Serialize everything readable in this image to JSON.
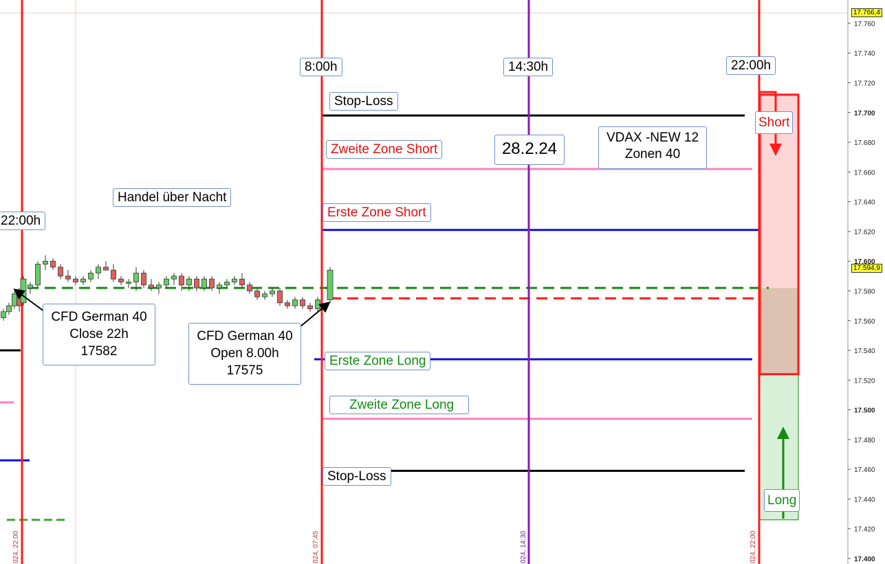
{
  "chart_data": {
    "type": "candlestick",
    "title": "",
    "xlabel": "",
    "ylabel": "",
    "ylim": [
      17400,
      17770
    ],
    "grid": true,
    "price_axis": {
      "ticks": [
        "17.760",
        "17.740",
        "17.720",
        "17.700",
        "17.680",
        "17.660",
        "17.640",
        "17.620",
        "17.600",
        "17.580",
        "17.560",
        "17.540",
        "17.520",
        "17.500",
        "17.480",
        "17.460",
        "17.440",
        "17.420",
        "17.400"
      ],
      "bold_ticks": [
        "17.700",
        "17.600",
        "17.500",
        "17.400"
      ],
      "tick_values": [
        17760,
        17740,
        17720,
        17700,
        17680,
        17660,
        17640,
        17620,
        17600,
        17580,
        17560,
        17540,
        17520,
        17500,
        17480,
        17460,
        17440,
        17420,
        17400
      ],
      "current_high_label": "17.766,4",
      "current_high_value": 17766.4,
      "last_price_label": "17.594,9",
      "last_price_value": 17594.9
    },
    "time_markers": [
      {
        "label": "22:00h",
        "stamp": "024, 22:00",
        "color": "#ff1a1a"
      },
      {
        "label": "8:00h",
        "stamp": "024, 07:45",
        "color": "#ff1a1a"
      },
      {
        "label": "14:30h",
        "stamp": "024, 14:30",
        "color": "#8a1ab8"
      },
      {
        "label": "22:00h",
        "stamp": "024, 22:00",
        "color": "#ff1a1a"
      }
    ],
    "candles_ohlc": [
      [
        17562,
        17568,
        17560,
        17566
      ],
      [
        17566,
        17572,
        17564,
        17570
      ],
      [
        17570,
        17580,
        17568,
        17578
      ],
      [
        17578,
        17582,
        17566,
        17570
      ],
      [
        17572,
        17590,
        17570,
        17588
      ],
      [
        17582,
        17586,
        17578,
        17584
      ],
      [
        17584,
        17600,
        17582,
        17598
      ],
      [
        17598,
        17604,
        17594,
        17600
      ],
      [
        17600,
        17602,
        17594,
        17596
      ],
      [
        17596,
        17598,
        17588,
        17590
      ],
      [
        17590,
        17594,
        17586,
        17588
      ],
      [
        17588,
        17590,
        17584,
        17586
      ],
      [
        17586,
        17590,
        17584,
        17588
      ],
      [
        17588,
        17594,
        17586,
        17592
      ],
      [
        17592,
        17598,
        17588,
        17596
      ],
      [
        17596,
        17600,
        17594,
        17594
      ],
      [
        17594,
        17598,
        17586,
        17588
      ],
      [
        17588,
        17590,
        17584,
        17586
      ],
      [
        17586,
        17588,
        17582,
        17586
      ],
      [
        17586,
        17596,
        17580,
        17592
      ],
      [
        17592,
        17594,
        17582,
        17584
      ],
      [
        17584,
        17588,
        17580,
        17582
      ],
      [
        17582,
        17586,
        17578,
        17584
      ],
      [
        17584,
        17590,
        17582,
        17588
      ],
      [
        17588,
        17592,
        17584,
        17590
      ],
      [
        17590,
        17592,
        17580,
        17584
      ],
      [
        17584,
        17590,
        17580,
        17588
      ],
      [
        17588,
        17590,
        17580,
        17582
      ],
      [
        17582,
        17590,
        17580,
        17588
      ],
      [
        17588,
        17590,
        17580,
        17582
      ],
      [
        17582,
        17586,
        17578,
        17584
      ],
      [
        17584,
        17588,
        17582,
        17586
      ],
      [
        17586,
        17590,
        17584,
        17588
      ],
      [
        17588,
        17592,
        17582,
        17584
      ],
      [
        17584,
        17586,
        17578,
        17580
      ],
      [
        17580,
        17582,
        17574,
        17576
      ],
      [
        17576,
        17580,
        17574,
        17578
      ],
      [
        17578,
        17582,
        17576,
        17580
      ],
      [
        17580,
        17582,
        17570,
        17572
      ],
      [
        17572,
        17574,
        17568,
        17570
      ],
      [
        17570,
        17576,
        17568,
        17574
      ],
      [
        17574,
        17576,
        17568,
        17570
      ],
      [
        17570,
        17572,
        17566,
        17568
      ],
      [
        17568,
        17576,
        17566,
        17574
      ],
      [
        17574,
        17596,
        17572,
        17594
      ]
    ],
    "levels": [
      {
        "name": "Stop-Loss",
        "value": 17698,
        "color": "#000000",
        "style": "solid"
      },
      {
        "name": "Zweite Zone Short",
        "value": 17662,
        "color": "#ff80c0",
        "style": "solid"
      },
      {
        "name": "Erste Zone Short",
        "value": 17621,
        "color": "#1010e0",
        "style": "solid"
      },
      {
        "name": "Close",
        "value": 17582,
        "color": "#128a12",
        "style": "dashed"
      },
      {
        "name": "Open",
        "value": 17575,
        "color": "#ff1a1a",
        "style": "dashed"
      },
      {
        "name": "Erste Zone Long",
        "value": 17534,
        "color": "#1010e0",
        "style": "solid"
      },
      {
        "name": "Zweite Zone Long",
        "value": 17494,
        "color": "#ff80c0",
        "style": "solid"
      },
      {
        "name": "Stop-Loss",
        "value": 17459,
        "color": "#000000",
        "style": "solid"
      }
    ],
    "prior_levels": [
      {
        "value": 17540,
        "color": "#000000"
      },
      {
        "value": 17505,
        "color": "#ff80c0"
      },
      {
        "value": 17466,
        "color": "#1010e0"
      },
      {
        "value": 17426,
        "color": "#3aa83a"
      }
    ],
    "zones": {
      "short": {
        "from": 17582,
        "to": 17712,
        "color": "#ffd6d6",
        "border": "#ff1a1a"
      },
      "overlap": {
        "from": 17524,
        "to": 17582,
        "color": "#dcc2b0",
        "border": "#ff1a1a"
      },
      "long": {
        "from": 17426,
        "to": 17524,
        "color": "#d7f0d7",
        "border": "#158a15"
      }
    }
  },
  "labels": {
    "time_8": "8:00h",
    "time_1430": "14:30h",
    "time_22_right": "22:00h",
    "time_22_left": "22:00h",
    "stop_loss_top": "Stop-Loss",
    "zweite_zone_short": "Zweite Zone Short",
    "date": "28.2.24",
    "vdax_line1": "VDAX -NEW 12",
    "vdax_line2": "Zonen 40",
    "handel": "Handel über Nacht",
    "erste_zone_short": "Erste Zone Short",
    "cfd_close_line1": "CFD German 40",
    "cfd_close_line2": "Close 22h",
    "cfd_close_line3": "17582",
    "cfd_open_line1": "CFD German 40",
    "cfd_open_line2": "Open 8.00h",
    "cfd_open_line3": "17575",
    "erste_zone_long": "Erste Zone Long",
    "zweite_zone_long": "Zweite Zone Long",
    "stop_loss_bottom": "Stop-Loss",
    "short": "Short",
    "long": "Long"
  },
  "colors": {
    "marker_red": "#ff1a1a",
    "marker_purple": "#8a1ab8",
    "bull_candle": "#66cc66",
    "bear_candle": "#e06060",
    "grid": "#f3c8c8"
  }
}
